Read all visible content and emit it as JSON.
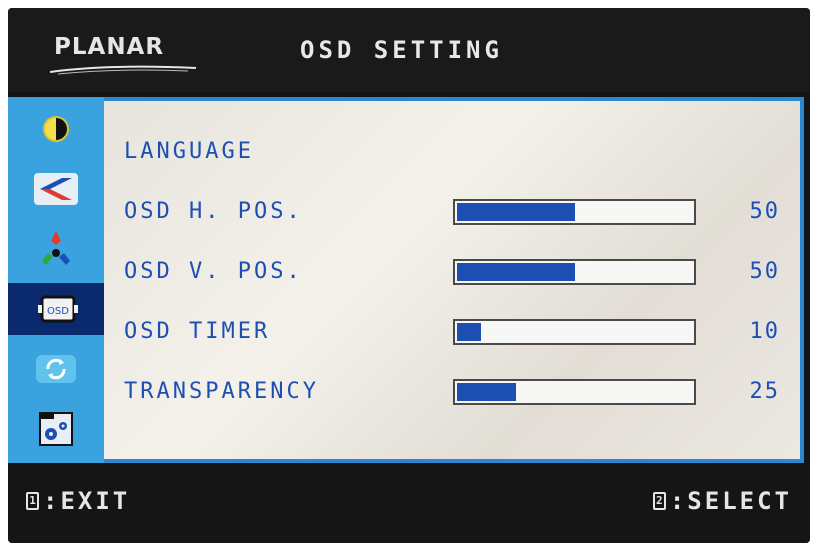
{
  "header": {
    "logo": "PLANAR",
    "title": "OSD SETTING"
  },
  "sidebar": {
    "tabs": [
      {
        "icon": "brightness-icon"
      },
      {
        "icon": "image-position-icon"
      },
      {
        "icon": "color-icon"
      },
      {
        "icon": "osd-icon",
        "label": "OSD",
        "active": true
      },
      {
        "icon": "reset-icon"
      },
      {
        "icon": "settings-icon"
      }
    ]
  },
  "menu": {
    "language_label": "LANGUAGE",
    "rows": [
      {
        "label": "OSD H. POS.",
        "value": "50",
        "level": 50
      },
      {
        "label": "OSD V. POS.",
        "value": "50",
        "level": 50
      },
      {
        "label": "OSD TIMER",
        "value": "10",
        "level": 10
      },
      {
        "label": "TRANSPARENCY",
        "value": "25",
        "level": 25
      }
    ]
  },
  "footer": {
    "exit_key": "1",
    "exit_label": ":EXIT",
    "select_key": "2",
    "select_label": ":SELECT"
  },
  "colors": {
    "accent": "#1d4fb3",
    "sidebar": "#3aa3df",
    "active_tab": "#0b2a6e",
    "bezel": "#141414"
  }
}
